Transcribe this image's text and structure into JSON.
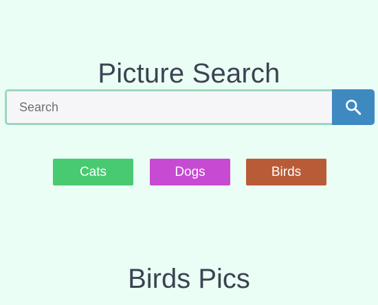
{
  "header": {
    "title": "Picture Search"
  },
  "search": {
    "placeholder": "Search",
    "value": "",
    "button_icon": "search-icon",
    "button_color": "#3f89c1",
    "border_color": "#9bd7c0"
  },
  "categories": [
    {
      "label": "Cats",
      "color": "#48ca70"
    },
    {
      "label": "Dogs",
      "color": "#c64ad2"
    },
    {
      "label": "Birds",
      "color": "#b85c38"
    }
  ],
  "results": {
    "title": "Birds Pics"
  },
  "theme": {
    "background": "#eafef5",
    "text": "#3b4350"
  }
}
